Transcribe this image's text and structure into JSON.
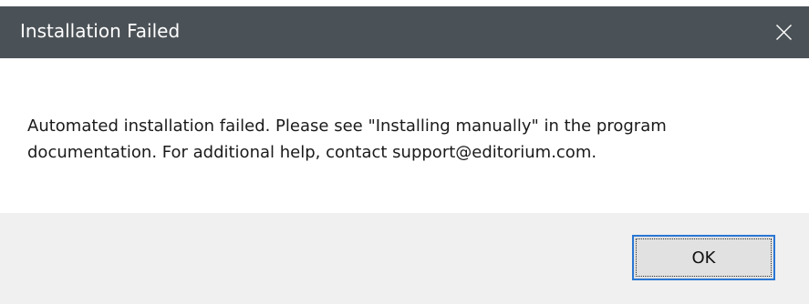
{
  "window": {
    "title": "Installation Failed",
    "close_icon": "close-icon",
    "title_bar_color": "#4b5257"
  },
  "message": {
    "text": "Automated installation failed. Please see \"Installing manually\" in the program documentation. For additional help, contact support@editorium.com."
  },
  "footer": {
    "ok_label": "OK",
    "focus_color": "#2a77d4"
  }
}
